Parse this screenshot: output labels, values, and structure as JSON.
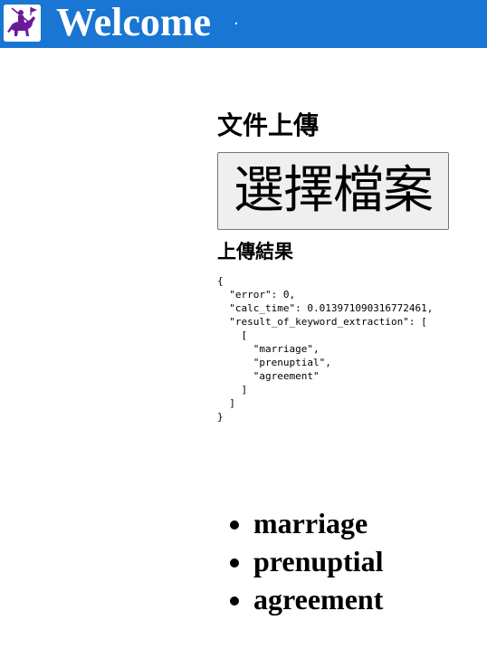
{
  "header": {
    "logo_icon": "horse-rider-logo-icon",
    "title": "Welcome",
    "separator": "·",
    "background_color": "#1976d2"
  },
  "upload": {
    "heading": "文件上傳",
    "file_button_label": "選擇檔案"
  },
  "result": {
    "heading": "上傳結果",
    "json_text": "{\n  \"error\": 0,\n  \"calc_time\": 0.013971090316772461,\n  \"result_of_keyword_extraction\": [\n    [\n      \"marriage\",\n      \"prenuptial\",\n      \"agreement\"\n    ]\n  ]\n}"
  },
  "keywords": [
    "marriage",
    "prenuptial",
    "agreement"
  ]
}
